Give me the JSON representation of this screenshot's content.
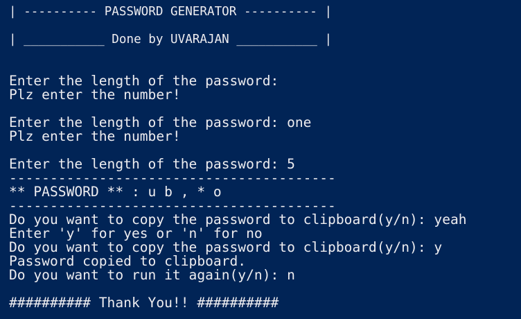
{
  "terminal": {
    "background_color": "#012456",
    "text_color": "#eeedf0",
    "banner": {
      "title_line": "| ---------- PASSWORD GENERATOR ---------- |",
      "author_line": "| ___________ Done by UVARAJAN ___________ |"
    },
    "lines": [
      "Enter the length of the password:",
      "Plz enter the number!",
      "Enter the length of the password: one",
      "Plz enter the number!",
      "Enter the length of the password: 5",
      "----------------------------------------",
      "** PASSWORD ** : u b , * o",
      "----------------------------------------",
      "Do you want to copy the password to clipboard(y/n): yeah",
      "Enter 'y' for yes or 'n' for no",
      "Do you want to copy the password to clipboard(y/n): y",
      "Password copied to clipboard.",
      "Do you want to run it again(y/n): n",
      "########## Thank You!! ##########"
    ]
  }
}
